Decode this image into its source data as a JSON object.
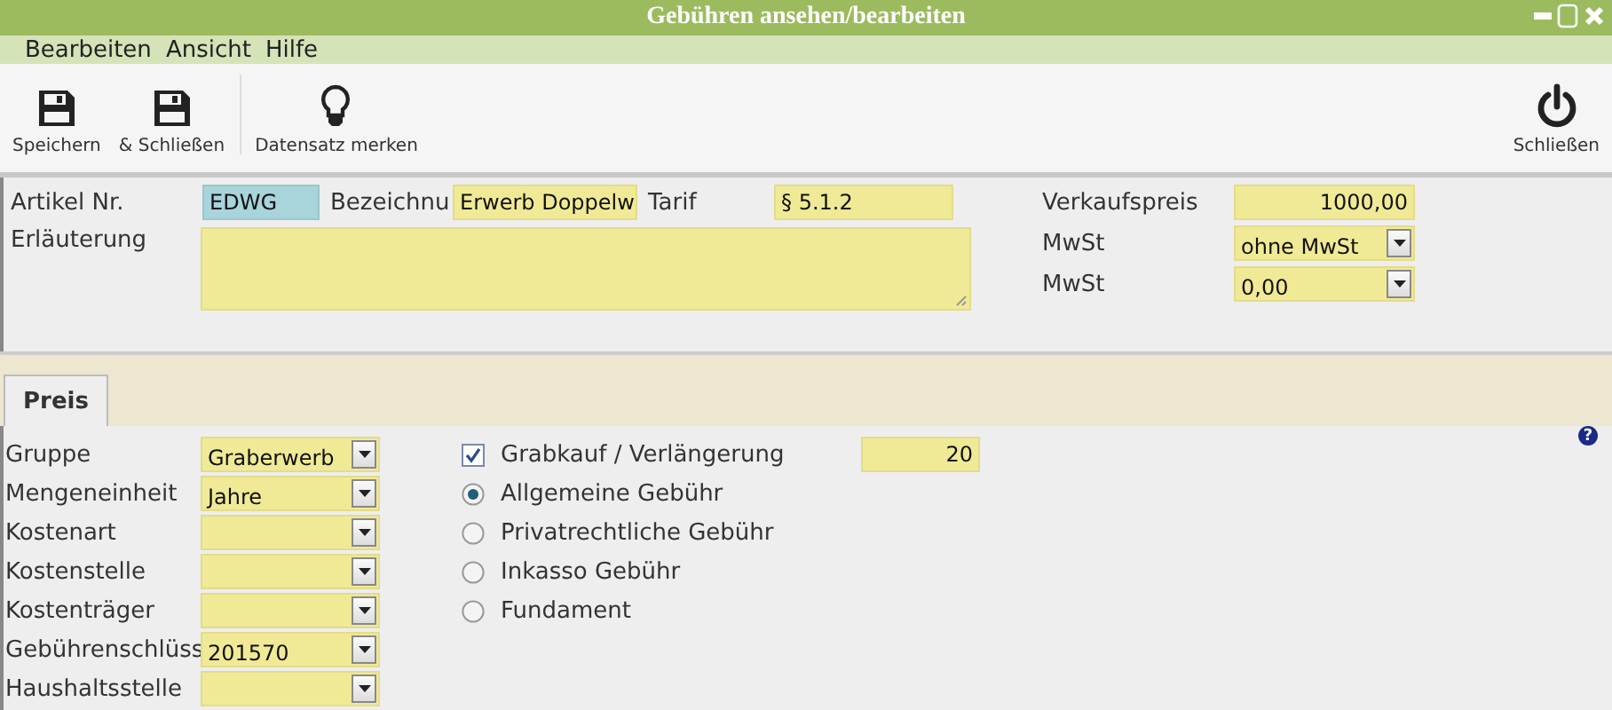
{
  "window": {
    "title": "Gebühren ansehen/bearbeiten"
  },
  "menu": [
    "Bearbeiten",
    "Ansicht",
    "Hilfe"
  ],
  "toolbar": {
    "left": [
      {
        "label": "Speichern",
        "kind": "save"
      },
      {
        "label": "& Schließen",
        "kind": "save"
      },
      {
        "label": "Datensatz merken",
        "kind": "bulb"
      }
    ],
    "right": [
      {
        "label": "Schließen",
        "kind": "power"
      }
    ]
  },
  "header": {
    "artikel_nr": {
      "label": "Artikel Nr.",
      "value": "EDWG"
    },
    "bezeichnung": {
      "label": "Bezeichnu",
      "value": "Erwerb Doppelw"
    },
    "tarif": {
      "label": "Tarif",
      "value": "§ 5.1.2"
    },
    "erlaeuterung": {
      "label": "Erläuterung"
    },
    "verkaufspreis": {
      "label": "Verkaufspreis",
      "value": "1000,00"
    },
    "mwst": {
      "label": "MwSt",
      "value": "ohne MwSt"
    },
    "mwst_satz": {
      "label": "MwSt",
      "value": "0,00"
    }
  },
  "tabs": [
    {
      "label": "Preis",
      "selected": true
    }
  ],
  "preis": {
    "fields": [
      {
        "label": "Gruppe",
        "value": "Graberwerb"
      },
      {
        "label": "Mengeneinheit",
        "value": "Jahre"
      },
      {
        "label": "Kostenart"
      },
      {
        "label": "Kostenstelle"
      },
      {
        "label": "Kostenträger"
      },
      {
        "label": "Gebührenschlüss",
        "value": "201570"
      },
      {
        "label": "Haushaltsstelle"
      }
    ],
    "options": [
      {
        "kind": "checkbox",
        "label": "Grabkauf / Verlängerung",
        "checked": true,
        "value": "20"
      },
      {
        "kind": "radio",
        "label": "Allgemeine Gebühr",
        "selected": true
      },
      {
        "kind": "radio",
        "label": "Privatrechtliche Gebühr",
        "selected": false
      },
      {
        "kind": "radio",
        "label": "Inkasso Gebühr",
        "selected": false
      },
      {
        "kind": "radio",
        "label": "Fundament",
        "selected": false
      }
    ],
    "help": "?"
  }
}
